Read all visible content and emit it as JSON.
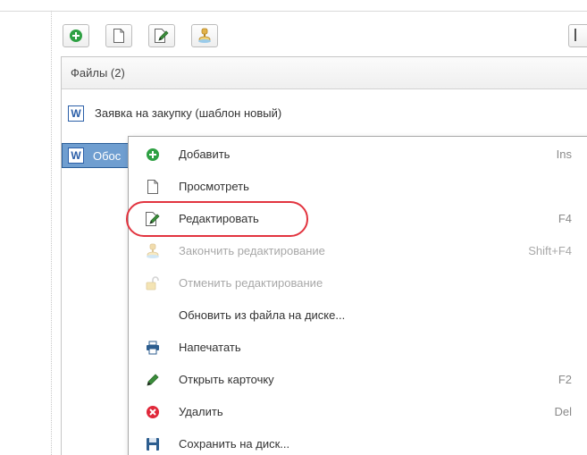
{
  "toolbar": {
    "buttons": [
      {
        "name": "add",
        "icon": "plus-circle-icon"
      },
      {
        "name": "view",
        "icon": "document-icon"
      },
      {
        "name": "edit",
        "icon": "pencil-document-icon"
      },
      {
        "name": "finish-edit",
        "icon": "stamp-icon"
      }
    ]
  },
  "files": {
    "header": "Файлы (2)",
    "rows": [
      {
        "icon_letter": "W",
        "text": "Заявка на закупку (шаблон новый)",
        "selected": false
      },
      {
        "icon_letter": "W",
        "text": "Обос",
        "selected": true
      }
    ]
  },
  "context_menu": {
    "items": [
      {
        "label": "Добавить",
        "shortcut": "Ins",
        "icon": "plus-circle-icon",
        "disabled": false
      },
      {
        "label": "Просмотреть",
        "shortcut": "",
        "icon": "document-icon",
        "disabled": false
      },
      {
        "label": "Редактировать",
        "shortcut": "F4",
        "icon": "pencil-document-icon",
        "disabled": false,
        "highlighted": true
      },
      {
        "label": "Закончить редактирование",
        "shortcut": "Shift+F4",
        "icon": "stamp-icon",
        "disabled": true
      },
      {
        "label": "Отменить редактирование",
        "shortcut": "",
        "icon": "unlock-icon",
        "disabled": true
      },
      {
        "label": "Обновить из файла на диске...",
        "shortcut": "",
        "icon": "",
        "disabled": false
      },
      {
        "label": "Напечатать",
        "shortcut": "",
        "icon": "printer-icon",
        "disabled": false
      },
      {
        "label": "Открыть карточку",
        "shortcut": "F2",
        "icon": "pencil-icon",
        "disabled": false
      },
      {
        "label": "Удалить",
        "shortcut": "Del",
        "icon": "delete-circle-icon",
        "disabled": false
      },
      {
        "label": "Сохранить на диск...",
        "shortcut": "",
        "icon": "floppy-disk-icon",
        "disabled": false
      }
    ]
  },
  "colors": {
    "accent_green": "#2ea043",
    "delete_red": "#e0283a",
    "selection_blue": "#6f9ed0",
    "highlight_ring": "#e2343f"
  }
}
